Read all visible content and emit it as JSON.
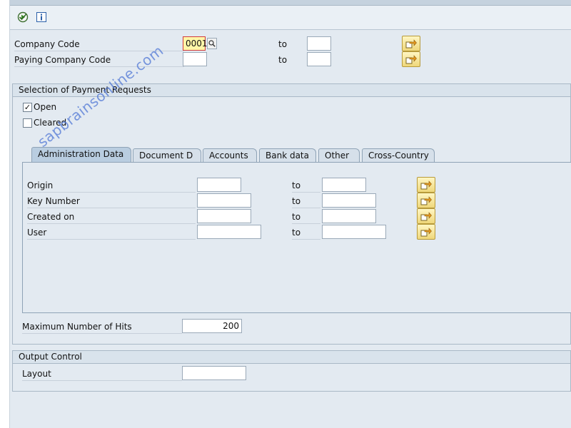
{
  "toolbar": {
    "execute_icon": "execute-icon",
    "info_icon": "info-icon"
  },
  "selection": {
    "company_code_label": "Company Code",
    "company_code_value": "0001",
    "paying_company_code_label": "Paying Company Code",
    "to_label": "to"
  },
  "payment_requests": {
    "title": "Selection of Payment Requests",
    "open_label": "Open",
    "open_checked": true,
    "cleared_label": "Cleared",
    "cleared_checked": false
  },
  "tabs": [
    {
      "label": "Administration Data"
    },
    {
      "label": "Document D"
    },
    {
      "label": "Accounts"
    },
    {
      "label": "Bank data"
    },
    {
      "label": "Other"
    },
    {
      "label": "Cross-Country"
    }
  ],
  "admin_fields": {
    "origin_label": "Origin",
    "key_number_label": "Key Number",
    "created_on_label": "Created on",
    "user_label": "User",
    "to_label": "to"
  },
  "max_hits": {
    "label": "Maximum Number of Hits",
    "value": "200"
  },
  "output_control": {
    "title": "Output Control",
    "layout_label": "Layout"
  },
  "watermark": "sapbrainsonline.com"
}
